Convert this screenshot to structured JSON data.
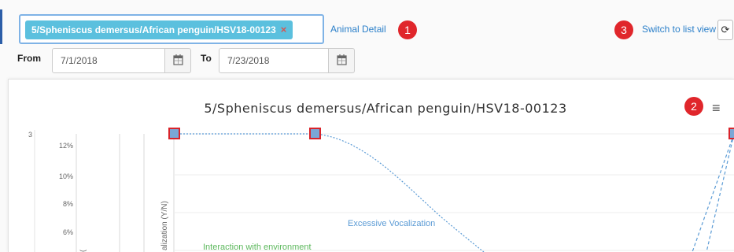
{
  "animal_select": {
    "tag_label": "5/Spheniscus demersus/African penguin/HSV18-00123",
    "remove_glyph": "×"
  },
  "links": {
    "animal_detail": "Animal Detail",
    "switch_view": "Switch to list view"
  },
  "callouts": [
    "1",
    "2",
    "3"
  ],
  "date_range": {
    "from_label": "From",
    "from_value": "7/1/2018",
    "to_label": "To",
    "to_value": "7/23/2018"
  },
  "icons": {
    "calendar": "calendar-icon",
    "refresh": "refresh-icon",
    "menu": "hamburger-menu-icon"
  },
  "colors": {
    "tag_bg": "#5bc0de",
    "link": "#2a7fc9",
    "callout": "#e0262b",
    "series_blue": "#5b9bd5",
    "series_green": "#5cb85c",
    "marker_border": "#d9232a"
  },
  "chart_data": {
    "type": "line",
    "title": "5/Spheniscus demersus/African penguin/HSV18-00123",
    "left_axis_ticks": [
      "3"
    ],
    "percent_axis_ticks": [
      "12%",
      "10%",
      "8%",
      "6%"
    ],
    "axis_title_fragment": "alization (Y/N)",
    "series": [
      {
        "name": "Excessive Vocalization",
        "values": [
          3,
          3,
          null,
          3
        ]
      },
      {
        "name": "Interaction with environment",
        "values": []
      }
    ]
  }
}
